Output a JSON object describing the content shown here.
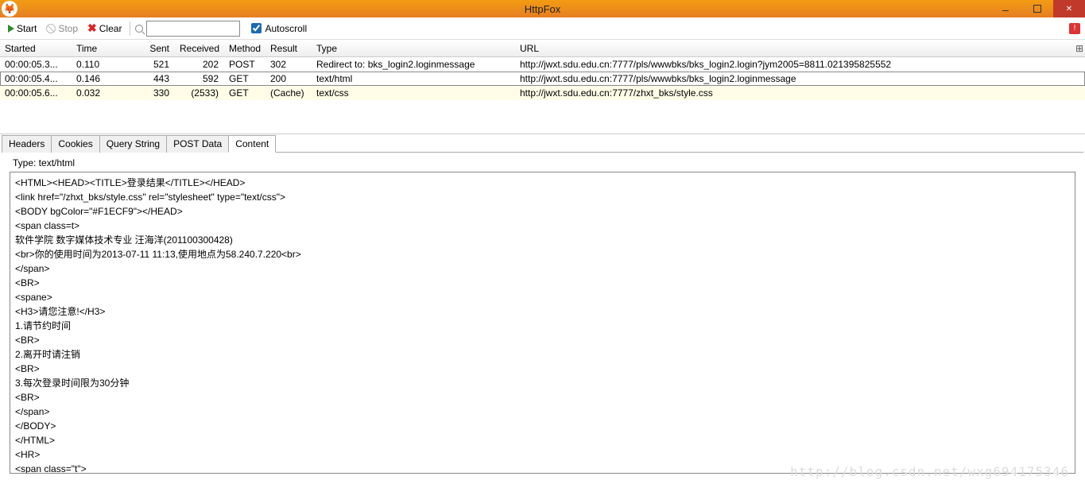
{
  "window": {
    "title": "HttpFox"
  },
  "toolbar": {
    "start": "Start",
    "stop": "Stop",
    "clear": "Clear",
    "autoscroll": "Autoscroll",
    "search_value": ""
  },
  "columns": {
    "started": "Started",
    "time": "Time",
    "sent": "Sent",
    "received": "Received",
    "method": "Method",
    "result": "Result",
    "type": "Type",
    "url": "URL"
  },
  "rows": [
    {
      "started": "00:00:05.3...",
      "time": "0.110",
      "sent": "521",
      "recv": "202",
      "method": "POST",
      "result": "302",
      "type": "Redirect to: bks_login2.loginmessage",
      "url": "http://jwxt.sdu.edu.cn:7777/pls/wwwbks/bks_login2.login?jym2005=8811.021395825552"
    },
    {
      "started": "00:00:05.4...",
      "time": "0.146",
      "sent": "443",
      "recv": "592",
      "method": "GET",
      "result": "200",
      "type": "text/html",
      "url": "http://jwxt.sdu.edu.cn:7777/pls/wwwbks/bks_login2.loginmessage"
    },
    {
      "started": "00:00:05.6...",
      "time": "0.032",
      "sent": "330",
      "recv": "(2533)",
      "method": "GET",
      "result": "(Cache)",
      "type": "text/css",
      "url": "http://jwxt.sdu.edu.cn:7777/zhxt_bks/style.css"
    }
  ],
  "tabs": {
    "headers": "Headers",
    "cookies": "Cookies",
    "query": "Query String",
    "post": "POST Data",
    "content": "Content"
  },
  "content_type_line": "Type: text/html",
  "content_body": "<HTML><HEAD><TITLE>登录结果</TITLE></HEAD>\n<link href=\"/zhxt_bks/style.css\" rel=\"stylesheet\" type=\"text/css\">\n<BODY bgColor=\"#F1ECF9\"></HEAD>\n<span class=t>\n软件学院 数字媒体技术专业 汪海洋(201100300428)\n<br>你的使用时间为2013-07-11 11:13,使用地点为58.240.7.220<br>\n</span>\n<BR>\n<spane>\n<H3>请您注意!</H3>\n1.请节约时间\n<BR>\n2.离开时请注销\n<BR>\n3.每次登录时间限为30分钟\n<BR>\n</span>\n</BODY>\n</HTML>\n<HR>\n<span class=\"t\">\n登录成功!\n</span>\n|",
  "watermark": "http://blog.csdn.net/wxg694175346"
}
